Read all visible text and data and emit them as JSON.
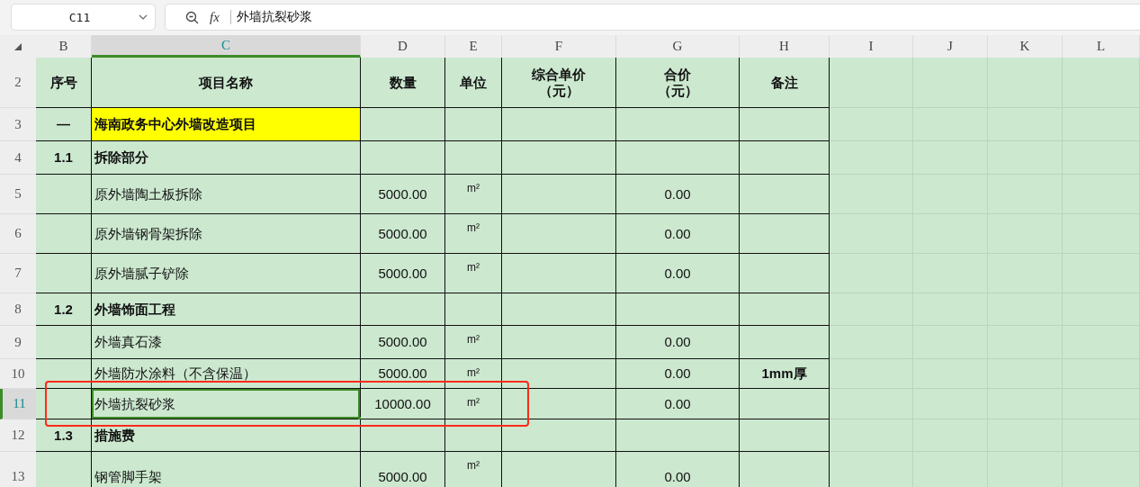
{
  "name_box": {
    "value": "C11"
  },
  "formula": {
    "function_label": "fx",
    "value": "外墙抗裂砂浆"
  },
  "columns": [
    {
      "label": "B",
      "selected": false
    },
    {
      "label": "C",
      "selected": true
    },
    {
      "label": "D",
      "selected": false
    },
    {
      "label": "E",
      "selected": false
    },
    {
      "label": "F",
      "selected": false
    },
    {
      "label": "G",
      "selected": false
    },
    {
      "label": "H",
      "selected": false
    },
    {
      "label": "I",
      "selected": false
    },
    {
      "label": "J",
      "selected": false
    },
    {
      "label": "K",
      "selected": false
    },
    {
      "label": "L",
      "selected": false
    }
  ],
  "rows": [
    {
      "number": "2",
      "kind": "header",
      "selected": false,
      "cells": {
        "B": "序号",
        "C": "项目名称",
        "D": "数量",
        "E": "单位",
        "F": [
          "综合单价",
          "（元）"
        ],
        "G": [
          "合价",
          "（元）"
        ],
        "H": "备注"
      }
    },
    {
      "number": "3",
      "kind": "title",
      "selected": false,
      "highlighted": true,
      "cells": {
        "B": "—",
        "C": "海南政务中心外墙改造项目"
      }
    },
    {
      "number": "4",
      "kind": "section",
      "selected": false,
      "cells": {
        "B": "1.1",
        "C": "拆除部分"
      }
    },
    {
      "number": "5",
      "kind": "item",
      "selected": false,
      "cells": {
        "C": "原外墙陶土板拆除",
        "D": "5000.00",
        "E": "m²",
        "G": "0.00"
      }
    },
    {
      "number": "6",
      "kind": "item",
      "selected": false,
      "cells": {
        "C": "原外墙钢骨架拆除",
        "D": "5000.00",
        "E": "m²",
        "G": "0.00"
      }
    },
    {
      "number": "7",
      "kind": "item",
      "selected": false,
      "cells": {
        "C": "原外墙腻子铲除",
        "D": "5000.00",
        "E": "m²",
        "G": "0.00"
      }
    },
    {
      "number": "8",
      "kind": "section",
      "selected": false,
      "cells": {
        "B": "1.2",
        "C": "外墙饰面工程"
      }
    },
    {
      "number": "9",
      "kind": "item",
      "selected": false,
      "cells": {
        "C": "外墙真石漆",
        "D": "5000.00",
        "E": "m²",
        "G": "0.00"
      }
    },
    {
      "number": "10",
      "kind": "item",
      "selected": false,
      "cells": {
        "C": "外墙防水涂料（不含保温）",
        "D": "5000.00",
        "E": "m²",
        "G": "0.00",
        "H": "1mm厚"
      }
    },
    {
      "number": "11",
      "kind": "item",
      "selected": true,
      "cells": {
        "C": "外墙抗裂砂浆",
        "D": "10000.00",
        "E": "m²",
        "G": "0.00"
      }
    },
    {
      "number": "12",
      "kind": "section",
      "selected": false,
      "cells": {
        "B": "1.3",
        "C": "措施费"
      }
    },
    {
      "number": "13",
      "kind": "item",
      "selected": false,
      "cells": {
        "C": "钢管脚手架",
        "D": "5000.00",
        "E": "m²",
        "G": "0.00"
      }
    }
  ]
}
